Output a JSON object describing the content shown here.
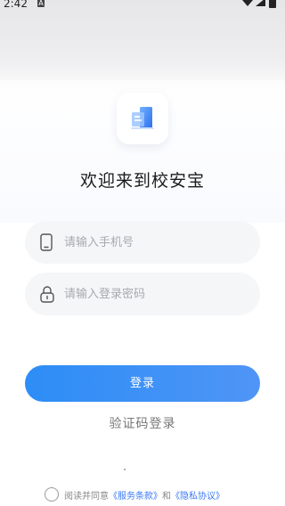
{
  "status_bar": {
    "time": "2:42",
    "notification": "A"
  },
  "app": {
    "logo_icon": "school-building-icon",
    "title": "欢迎来到校安宝"
  },
  "login_form": {
    "phone_placeholder": "请输入手机号",
    "password_placeholder": "请输入登录密码",
    "login_label": "登录",
    "sms_login_label": "验证码登录"
  },
  "agreement": {
    "prefix": "阅读并同意",
    "terms_link": "《服务条款》",
    "conjunction": "和",
    "privacy_link": "《隐私协议》"
  },
  "colors": {
    "accent": "#2d8df6",
    "link": "#3b79f5"
  }
}
